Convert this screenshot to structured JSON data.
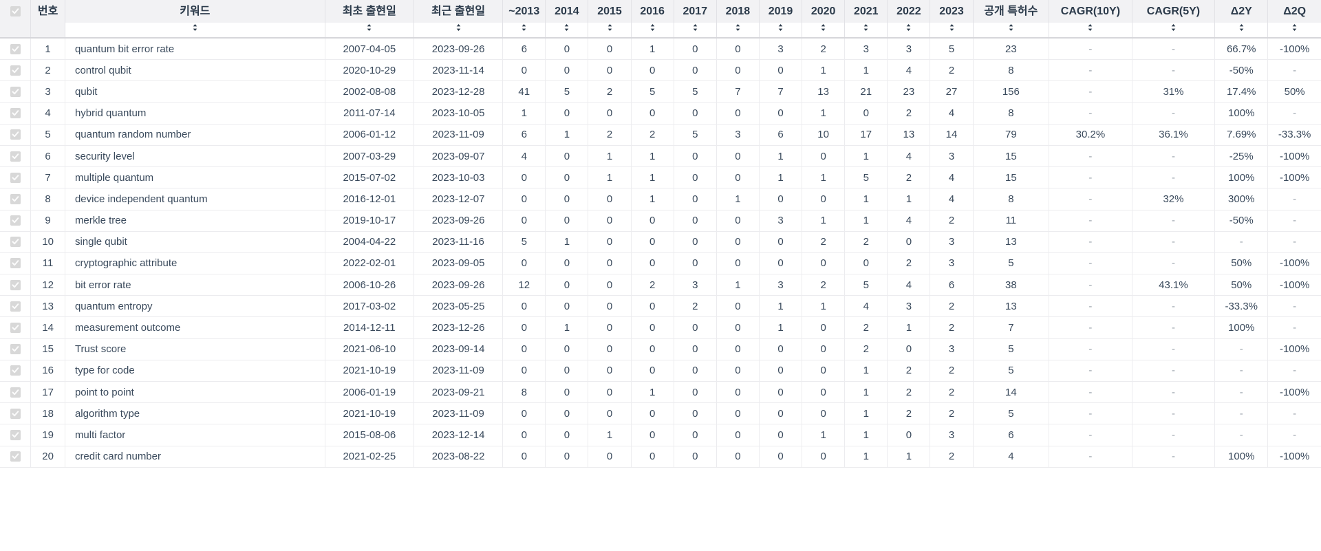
{
  "table": {
    "header": {
      "select_all_icon": "checkbox-checked-icon",
      "columns": [
        {
          "key": "no",
          "label": "번호",
          "sortable": false
        },
        {
          "key": "kw",
          "label": "키워드",
          "sortable": true
        },
        {
          "key": "first",
          "label": "최초 출현일",
          "sortable": true
        },
        {
          "key": "last",
          "label": "최근 출현일",
          "sortable": true
        },
        {
          "key": "y2013",
          "label": "~2013",
          "sortable": true
        },
        {
          "key": "y2014",
          "label": "2014",
          "sortable": true
        },
        {
          "key": "y2015",
          "label": "2015",
          "sortable": true
        },
        {
          "key": "y2016",
          "label": "2016",
          "sortable": true
        },
        {
          "key": "y2017",
          "label": "2017",
          "sortable": true
        },
        {
          "key": "y2018",
          "label": "2018",
          "sortable": true
        },
        {
          "key": "y2019",
          "label": "2019",
          "sortable": true
        },
        {
          "key": "y2020",
          "label": "2020",
          "sortable": true
        },
        {
          "key": "y2021",
          "label": "2021",
          "sortable": true
        },
        {
          "key": "y2022",
          "label": "2022",
          "sortable": true
        },
        {
          "key": "y2023",
          "label": "2023",
          "sortable": true
        },
        {
          "key": "total",
          "label": "공개 특허수",
          "sortable": true
        },
        {
          "key": "cagr10",
          "label": "CAGR(10Y)",
          "sortable": true
        },
        {
          "key": "cagr5",
          "label": "CAGR(5Y)",
          "sortable": true
        },
        {
          "key": "d2y",
          "label": "Δ2Y",
          "sortable": true
        },
        {
          "key": "d2q",
          "label": "Δ2Q",
          "sortable": true
        }
      ],
      "sort_icon": "sort-updown-icon"
    },
    "rows": [
      {
        "no": "1",
        "kw": "quantum bit error rate",
        "first": "2007-04-05",
        "last": "2023-09-26",
        "y2013": "6",
        "y2014": "0",
        "y2015": "0",
        "y2016": "1",
        "y2017": "0",
        "y2018": "0",
        "y2019": "3",
        "y2020": "2",
        "y2021": "3",
        "y2022": "3",
        "y2023": "5",
        "total": "23",
        "cagr10": "-",
        "cagr5": "-",
        "d2y": "66.7%",
        "d2q": "-100%"
      },
      {
        "no": "2",
        "kw": "control qubit",
        "first": "2020-10-29",
        "last": "2023-11-14",
        "y2013": "0",
        "y2014": "0",
        "y2015": "0",
        "y2016": "0",
        "y2017": "0",
        "y2018": "0",
        "y2019": "0",
        "y2020": "1",
        "y2021": "1",
        "y2022": "4",
        "y2023": "2",
        "total": "8",
        "cagr10": "-",
        "cagr5": "-",
        "d2y": "-50%",
        "d2q": "-"
      },
      {
        "no": "3",
        "kw": "qubit",
        "first": "2002-08-08",
        "last": "2023-12-28",
        "y2013": "41",
        "y2014": "5",
        "y2015": "2",
        "y2016": "5",
        "y2017": "5",
        "y2018": "7",
        "y2019": "7",
        "y2020": "13",
        "y2021": "21",
        "y2022": "23",
        "y2023": "27",
        "total": "156",
        "cagr10": "-",
        "cagr5": "31%",
        "d2y": "17.4%",
        "d2q": "50%"
      },
      {
        "no": "4",
        "kw": "hybrid quantum",
        "first": "2011-07-14",
        "last": "2023-10-05",
        "y2013": "1",
        "y2014": "0",
        "y2015": "0",
        "y2016": "0",
        "y2017": "0",
        "y2018": "0",
        "y2019": "0",
        "y2020": "1",
        "y2021": "0",
        "y2022": "2",
        "y2023": "4",
        "total": "8",
        "cagr10": "-",
        "cagr5": "-",
        "d2y": "100%",
        "d2q": "-"
      },
      {
        "no": "5",
        "kw": "quantum random number",
        "first": "2006-01-12",
        "last": "2023-11-09",
        "y2013": "6",
        "y2014": "1",
        "y2015": "2",
        "y2016": "2",
        "y2017": "5",
        "y2018": "3",
        "y2019": "6",
        "y2020": "10",
        "y2021": "17",
        "y2022": "13",
        "y2023": "14",
        "total": "79",
        "cagr10": "30.2%",
        "cagr5": "36.1%",
        "d2y": "7.69%",
        "d2q": "-33.3%"
      },
      {
        "no": "6",
        "kw": "security level",
        "first": "2007-03-29",
        "last": "2023-09-07",
        "y2013": "4",
        "y2014": "0",
        "y2015": "1",
        "y2016": "1",
        "y2017": "0",
        "y2018": "0",
        "y2019": "1",
        "y2020": "0",
        "y2021": "1",
        "y2022": "4",
        "y2023": "3",
        "total": "15",
        "cagr10": "-",
        "cagr5": "-",
        "d2y": "-25%",
        "d2q": "-100%"
      },
      {
        "no": "7",
        "kw": "multiple quantum",
        "first": "2015-07-02",
        "last": "2023-10-03",
        "y2013": "0",
        "y2014": "0",
        "y2015": "1",
        "y2016": "1",
        "y2017": "0",
        "y2018": "0",
        "y2019": "1",
        "y2020": "1",
        "y2021": "5",
        "y2022": "2",
        "y2023": "4",
        "total": "15",
        "cagr10": "-",
        "cagr5": "-",
        "d2y": "100%",
        "d2q": "-100%"
      },
      {
        "no": "8",
        "kw": "device independent quantum",
        "first": "2016-12-01",
        "last": "2023-12-07",
        "y2013": "0",
        "y2014": "0",
        "y2015": "0",
        "y2016": "1",
        "y2017": "0",
        "y2018": "1",
        "y2019": "0",
        "y2020": "0",
        "y2021": "1",
        "y2022": "1",
        "y2023": "4",
        "total": "8",
        "cagr10": "-",
        "cagr5": "32%",
        "d2y": "300%",
        "d2q": "-"
      },
      {
        "no": "9",
        "kw": "merkle tree",
        "first": "2019-10-17",
        "last": "2023-09-26",
        "y2013": "0",
        "y2014": "0",
        "y2015": "0",
        "y2016": "0",
        "y2017": "0",
        "y2018": "0",
        "y2019": "3",
        "y2020": "1",
        "y2021": "1",
        "y2022": "4",
        "y2023": "2",
        "total": "11",
        "cagr10": "-",
        "cagr5": "-",
        "d2y": "-50%",
        "d2q": "-"
      },
      {
        "no": "10",
        "kw": "single qubit",
        "first": "2004-04-22",
        "last": "2023-11-16",
        "y2013": "5",
        "y2014": "1",
        "y2015": "0",
        "y2016": "0",
        "y2017": "0",
        "y2018": "0",
        "y2019": "0",
        "y2020": "2",
        "y2021": "2",
        "y2022": "0",
        "y2023": "3",
        "total": "13",
        "cagr10": "-",
        "cagr5": "-",
        "d2y": "-",
        "d2q": "-"
      },
      {
        "no": "11",
        "kw": "cryptographic attribute",
        "first": "2022-02-01",
        "last": "2023-09-05",
        "y2013": "0",
        "y2014": "0",
        "y2015": "0",
        "y2016": "0",
        "y2017": "0",
        "y2018": "0",
        "y2019": "0",
        "y2020": "0",
        "y2021": "0",
        "y2022": "2",
        "y2023": "3",
        "total": "5",
        "cagr10": "-",
        "cagr5": "-",
        "d2y": "50%",
        "d2q": "-100%"
      },
      {
        "no": "12",
        "kw": "bit error rate",
        "first": "2006-10-26",
        "last": "2023-09-26",
        "y2013": "12",
        "y2014": "0",
        "y2015": "0",
        "y2016": "2",
        "y2017": "3",
        "y2018": "1",
        "y2019": "3",
        "y2020": "2",
        "y2021": "5",
        "y2022": "4",
        "y2023": "6",
        "total": "38",
        "cagr10": "-",
        "cagr5": "43.1%",
        "d2y": "50%",
        "d2q": "-100%"
      },
      {
        "no": "13",
        "kw": "quantum entropy",
        "first": "2017-03-02",
        "last": "2023-05-25",
        "y2013": "0",
        "y2014": "0",
        "y2015": "0",
        "y2016": "0",
        "y2017": "2",
        "y2018": "0",
        "y2019": "1",
        "y2020": "1",
        "y2021": "4",
        "y2022": "3",
        "y2023": "2",
        "total": "13",
        "cagr10": "-",
        "cagr5": "-",
        "d2y": "-33.3%",
        "d2q": "-"
      },
      {
        "no": "14",
        "kw": "measurement outcome",
        "first": "2014-12-11",
        "last": "2023-12-26",
        "y2013": "0",
        "y2014": "1",
        "y2015": "0",
        "y2016": "0",
        "y2017": "0",
        "y2018": "0",
        "y2019": "1",
        "y2020": "0",
        "y2021": "2",
        "y2022": "1",
        "y2023": "2",
        "total": "7",
        "cagr10": "-",
        "cagr5": "-",
        "d2y": "100%",
        "d2q": "-"
      },
      {
        "no": "15",
        "kw": "Trust score",
        "first": "2021-06-10",
        "last": "2023-09-14",
        "y2013": "0",
        "y2014": "0",
        "y2015": "0",
        "y2016": "0",
        "y2017": "0",
        "y2018": "0",
        "y2019": "0",
        "y2020": "0",
        "y2021": "2",
        "y2022": "0",
        "y2023": "3",
        "total": "5",
        "cagr10": "-",
        "cagr5": "-",
        "d2y": "-",
        "d2q": "-100%"
      },
      {
        "no": "16",
        "kw": "type for code",
        "first": "2021-10-19",
        "last": "2023-11-09",
        "y2013": "0",
        "y2014": "0",
        "y2015": "0",
        "y2016": "0",
        "y2017": "0",
        "y2018": "0",
        "y2019": "0",
        "y2020": "0",
        "y2021": "1",
        "y2022": "2",
        "y2023": "2",
        "total": "5",
        "cagr10": "-",
        "cagr5": "-",
        "d2y": "-",
        "d2q": "-"
      },
      {
        "no": "17",
        "kw": "point to point",
        "first": "2006-01-19",
        "last": "2023-09-21",
        "y2013": "8",
        "y2014": "0",
        "y2015": "0",
        "y2016": "1",
        "y2017": "0",
        "y2018": "0",
        "y2019": "0",
        "y2020": "0",
        "y2021": "1",
        "y2022": "2",
        "y2023": "2",
        "total": "14",
        "cagr10": "-",
        "cagr5": "-",
        "d2y": "-",
        "d2q": "-100%"
      },
      {
        "no": "18",
        "kw": "algorithm type",
        "first": "2021-10-19",
        "last": "2023-11-09",
        "y2013": "0",
        "y2014": "0",
        "y2015": "0",
        "y2016": "0",
        "y2017": "0",
        "y2018": "0",
        "y2019": "0",
        "y2020": "0",
        "y2021": "1",
        "y2022": "2",
        "y2023": "2",
        "total": "5",
        "cagr10": "-",
        "cagr5": "-",
        "d2y": "-",
        "d2q": "-"
      },
      {
        "no": "19",
        "kw": "multi factor",
        "first": "2015-08-06",
        "last": "2023-12-14",
        "y2013": "0",
        "y2014": "0",
        "y2015": "1",
        "y2016": "0",
        "y2017": "0",
        "y2018": "0",
        "y2019": "0",
        "y2020": "1",
        "y2021": "1",
        "y2022": "0",
        "y2023": "3",
        "total": "6",
        "cagr10": "-",
        "cagr5": "-",
        "d2y": "-",
        "d2q": "-"
      },
      {
        "no": "20",
        "kw": "credit card number",
        "first": "2021-02-25",
        "last": "2023-08-22",
        "y2013": "0",
        "y2014": "0",
        "y2015": "0",
        "y2016": "0",
        "y2017": "0",
        "y2018": "0",
        "y2019": "0",
        "y2020": "0",
        "y2021": "1",
        "y2022": "1",
        "y2023": "2",
        "total": "4",
        "cagr10": "-",
        "cagr5": "-",
        "d2y": "100%",
        "d2q": "-100%"
      }
    ],
    "row_checkbox_icon": "checkbox-checked-icon"
  },
  "colors": {
    "header_bg": "#f2f2f4",
    "text": "#2b3a4a",
    "row_border": "#ececef",
    "checkbox_fill": "#d8d8d8"
  }
}
